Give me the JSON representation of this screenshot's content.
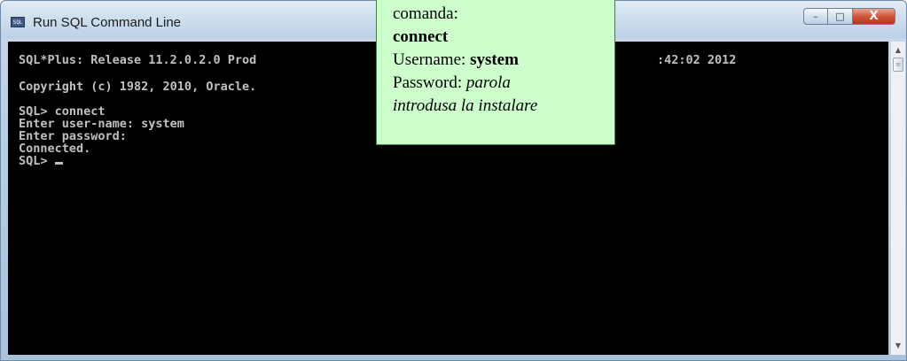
{
  "window": {
    "title": "Run SQL Command Line",
    "icon": "sqlplus-app-icon",
    "controls": {
      "minimize": "–",
      "maximize": "□",
      "close": "X"
    }
  },
  "console": {
    "line_release": "SQL*Plus: Release 11.2.0.2.0 Prod",
    "line_release_tail": ":42:02 2012",
    "line_copyright": "Copyright (c) 1982, 2010, Oracle.",
    "line_connect": "SQL> connect",
    "line_user": "Enter user-name: system",
    "line_password": "Enter password:",
    "line_connected": "Connected.",
    "line_prompt": "SQL>",
    "colors": {
      "background": "#000000",
      "text": "#c0c0c0"
    }
  },
  "callout": {
    "line1": "comanda:",
    "line2": "connect",
    "username_label": "Username: ",
    "username_value": "system",
    "password_label": "Password: ",
    "password_value_1": "parola",
    "password_value_2": "introdusa la instalare",
    "colors": {
      "background": "#ccffcc",
      "border": "#3f7f3f"
    }
  },
  "scrollbar": {
    "up": "▲",
    "down": "▼",
    "thumb_grip": "≡"
  }
}
